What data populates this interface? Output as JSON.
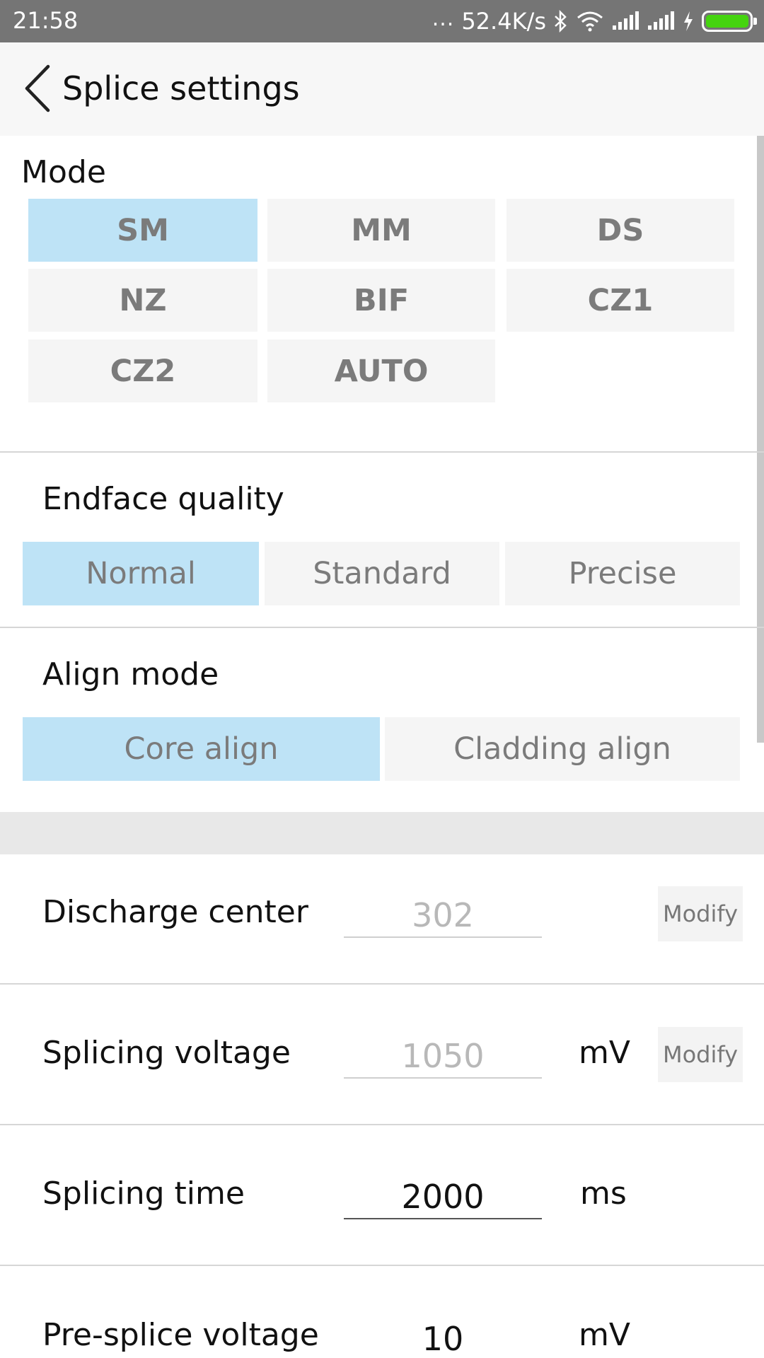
{
  "status_bar": {
    "time": "21:58",
    "dots": "...",
    "network_speed": "52.4K/s",
    "icons": [
      "bluetooth-icon",
      "wifi-icon",
      "signal-icon",
      "signal-icon",
      "charging-icon",
      "battery-icon"
    ],
    "battery_color": "#45d40f"
  },
  "header": {
    "title": "Splice settings",
    "back_icon": "chevron-left-icon"
  },
  "mode": {
    "title": "Mode",
    "options": [
      "SM",
      "MM",
      "DS",
      "NZ",
      "BIF",
      "CZ1",
      "CZ2",
      "AUTO"
    ],
    "selected": "SM"
  },
  "endface_quality": {
    "title": "Endface quality",
    "options": [
      "Normal",
      "Standard",
      "Precise"
    ],
    "selected": "Normal"
  },
  "align_mode": {
    "title": "Align mode",
    "options": [
      "Core align",
      "Cladding align"
    ],
    "selected": "Core align"
  },
  "params": [
    {
      "label": "Discharge center",
      "value": "302",
      "unit": "",
      "action": "Modify"
    },
    {
      "label": "Splicing voltage",
      "value": "1050",
      "unit": "mV",
      "action": "Modify"
    },
    {
      "label": "Splicing time",
      "value": "2000",
      "unit": "ms",
      "action": ""
    },
    {
      "label": "Pre-splice voltage",
      "value": "10",
      "unit": "mV",
      "action": ""
    }
  ],
  "colors": {
    "selected_bg": "#bee3f6",
    "option_bg": "#f5f5f5",
    "status_bar_bg": "#757575",
    "header_bg": "#f7f7f7"
  }
}
